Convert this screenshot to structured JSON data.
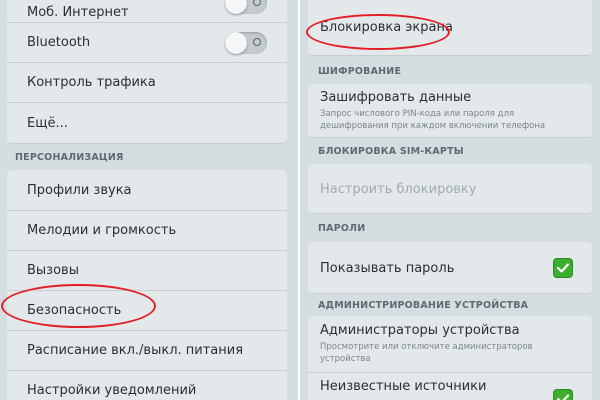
{
  "left": {
    "network_items": [
      {
        "label": "Моб. Интернет",
        "toggle_on": false
      },
      {
        "label": "Bluetooth",
        "toggle_on": false
      },
      {
        "label": "Контроль трафика"
      },
      {
        "label": "Ещё..."
      }
    ],
    "personalization_header": "ПЕРСОНАЛИЗАЦИЯ",
    "personalization_items": [
      {
        "label": "Профили звука"
      },
      {
        "label": "Мелодии и громкость"
      },
      {
        "label": "Вызовы"
      },
      {
        "label": "Безопасность",
        "highlighted": true
      },
      {
        "label": "Расписание вкл./выкл. питания"
      },
      {
        "label": "Настройки уведомлений"
      }
    ]
  },
  "right": {
    "screen_lock": {
      "label": "Блокировка экрана",
      "highlighted": true
    },
    "encryption_header": "ШИФРОВАНИЕ",
    "encrypt": {
      "title": "Зашифровать данные",
      "subtitle_line1": "Запрос числового PIN-кода или пароля для",
      "subtitle_line2": "дешифрования при каждом включении телефона"
    },
    "sim_header": "БЛОКИРОВКА SIM-КАРТЫ",
    "sim_lock": {
      "label": "Настроить блокировку",
      "disabled": true
    },
    "passwords_header": "ПАРОЛИ",
    "show_password": {
      "label": "Показывать пароль",
      "checked": true
    },
    "admin_header": "АДМИНИСТРИРОВАНИЕ УСТРОЙСТВА",
    "device_admins": {
      "title": "Администраторы устройства",
      "subtitle_line1": "Просмотрите или отключите администраторов",
      "subtitle_line2": "устройства"
    },
    "unknown_sources": {
      "title": "Неизвестные источники",
      "checked": true
    }
  },
  "colors": {
    "panel_bg": "#d6dde1",
    "card_bg": "#e3e8eb",
    "highlight_ellipse": "#e31e24",
    "checkbox_green": "#3cae2e"
  },
  "icons": {
    "toggle": "switch-off",
    "checkbox": "checkmark"
  }
}
